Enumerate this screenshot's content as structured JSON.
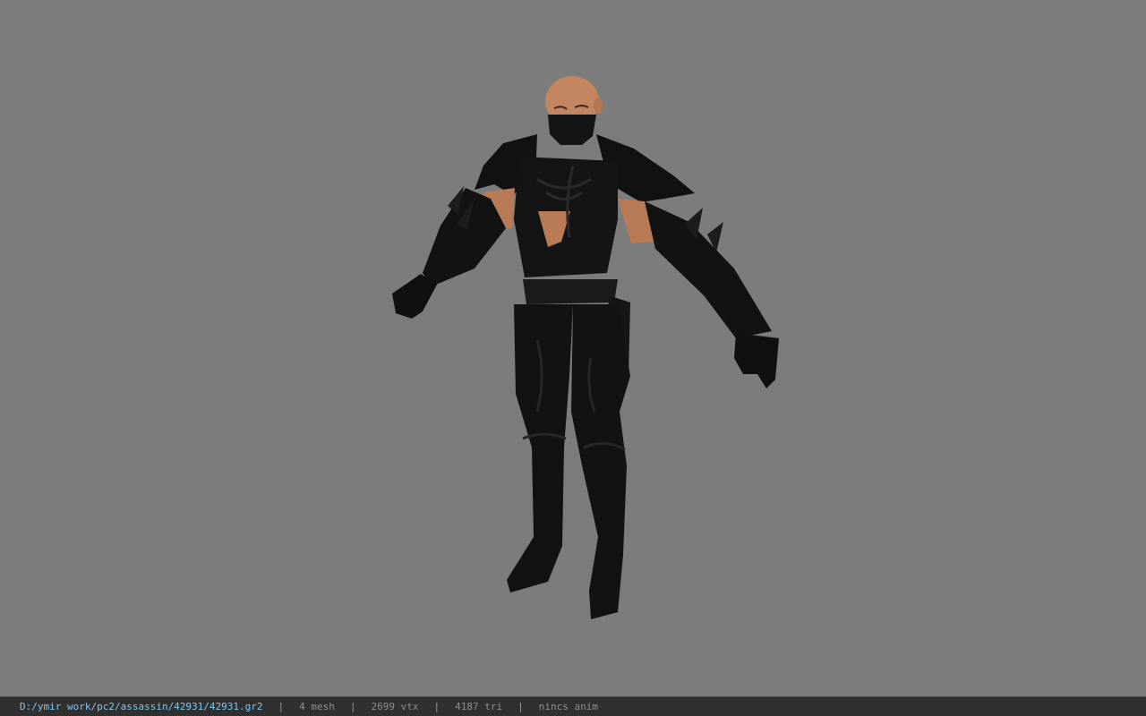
{
  "statusbar": {
    "file_path": "D:/ymir work/pc2/assassin/42931/42931.gr2",
    "separator": "|",
    "mesh_count": "4 mesh",
    "vertex_count": "2699 vtx",
    "triangle_count": "4187 tri",
    "anim_status": "nincs anim"
  },
  "colors": {
    "viewport_background": "#7c7c7c",
    "statusbar_background": "#303030",
    "path_text": "#7fc8ee",
    "stat_text": "#8e8e8e",
    "armor": "#121212",
    "skin": "#c98a62"
  }
}
